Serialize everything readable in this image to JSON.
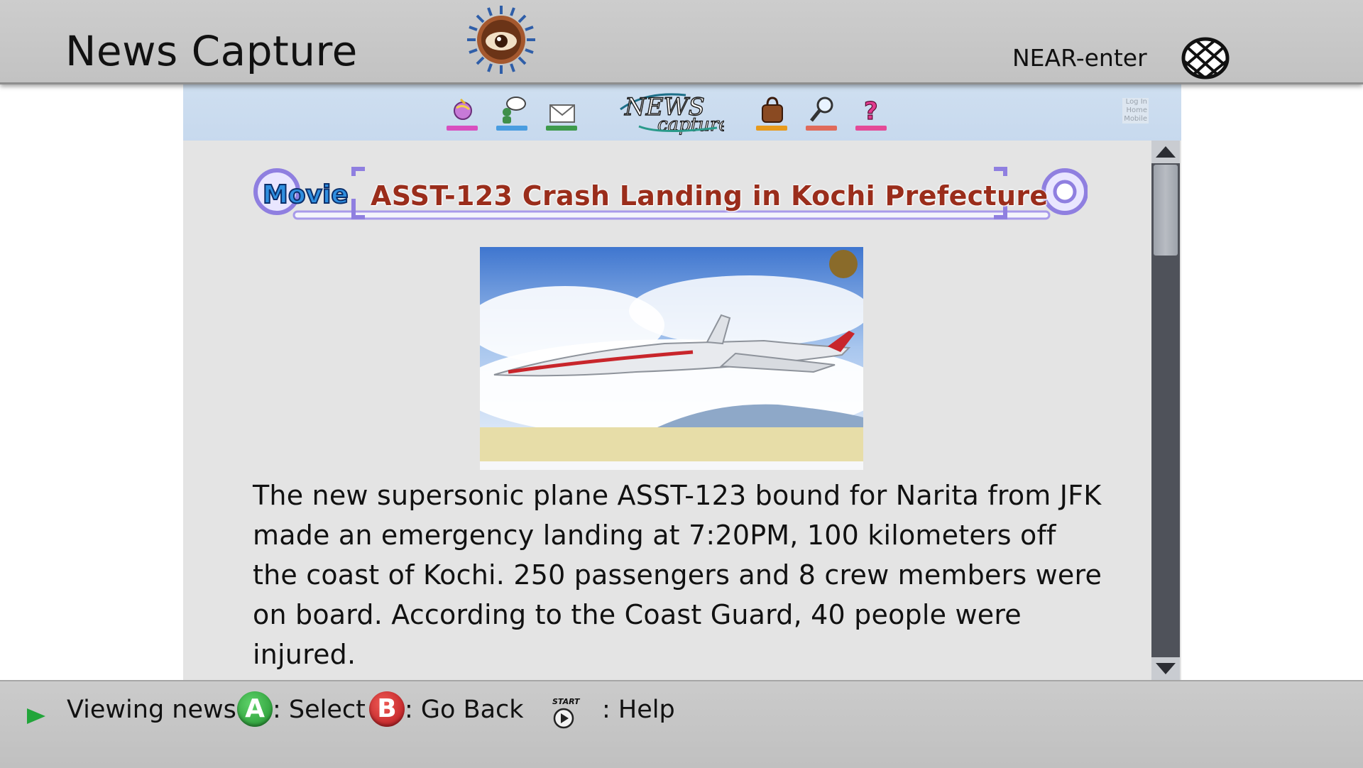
{
  "header": {
    "app_title": "News Capture",
    "network_status": "NEAR-enter"
  },
  "site": {
    "logo_text_1": "NEWS",
    "logo_text_2": "capture",
    "mini_links": [
      "Log In",
      "Home",
      "Mobile"
    ],
    "nav_icons": [
      {
        "name": "world-news-icon",
        "base_color": "#d84fbf"
      },
      {
        "name": "chat-news-icon",
        "base_color": "#4a9de0"
      },
      {
        "name": "mail-news-icon",
        "base_color": "#3e9a4c"
      },
      {
        "name": "shopping-bag-icon",
        "base_color": "#e79a1c"
      },
      {
        "name": "search-icon",
        "base_color": "#e06a5a"
      },
      {
        "name": "help-icon",
        "base_color": "#e44a97"
      }
    ]
  },
  "article": {
    "badge": "Movie",
    "headline": "ASST-123 Crash Landing in Kochi Prefecture",
    "body": "The new supersonic plane ASST-123 bound for Narita from JFK made an emergency landing at 7:20PM, 100 kilometers off the coast of Kochi. 250 passengers and 8 crew members were on board. According to the Coast Guard, 40 people were injured."
  },
  "help_bar": {
    "status": "Viewing news.",
    "a_label": "A",
    "a_action": ": Select",
    "b_label": "B",
    "b_action": ": Go Back",
    "start_label": "START",
    "start_action": ": Help"
  },
  "colors": {
    "headline": "#9a2d1b",
    "badge": "#2f8fe0",
    "frame_accent": "#8f7fe0",
    "nav_bg": "#cfdff0",
    "content_bg": "#e4e4e4",
    "scrollbar": "#4f525a"
  }
}
